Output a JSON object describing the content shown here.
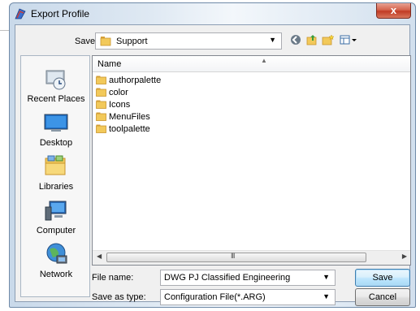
{
  "window": {
    "title": "Export Profile",
    "close_label": "x"
  },
  "save_in": {
    "label": "Save in:",
    "value": "Support"
  },
  "places": [
    {
      "label": "Recent Places",
      "icon": "recent-places-icon"
    },
    {
      "label": "Desktop",
      "icon": "desktop-icon"
    },
    {
      "label": "Libraries",
      "icon": "libraries-icon"
    },
    {
      "label": "Computer",
      "icon": "computer-icon"
    },
    {
      "label": "Network",
      "icon": "network-icon"
    }
  ],
  "filelist": {
    "column_name": "Name",
    "items": [
      "authorpalette",
      "color",
      "Icons",
      "MenuFiles",
      "toolpalette"
    ],
    "scroll_grip": "III"
  },
  "filename": {
    "label": "File name:",
    "value": "DWG PJ Classified Engineering"
  },
  "savetype": {
    "label": "Save as type:",
    "value": "Configuration File(*.ARG)"
  },
  "buttons": {
    "save": "Save",
    "cancel": "Cancel"
  },
  "colors": {
    "folder": "#e8b84a",
    "accent": "#3c7fb1"
  }
}
